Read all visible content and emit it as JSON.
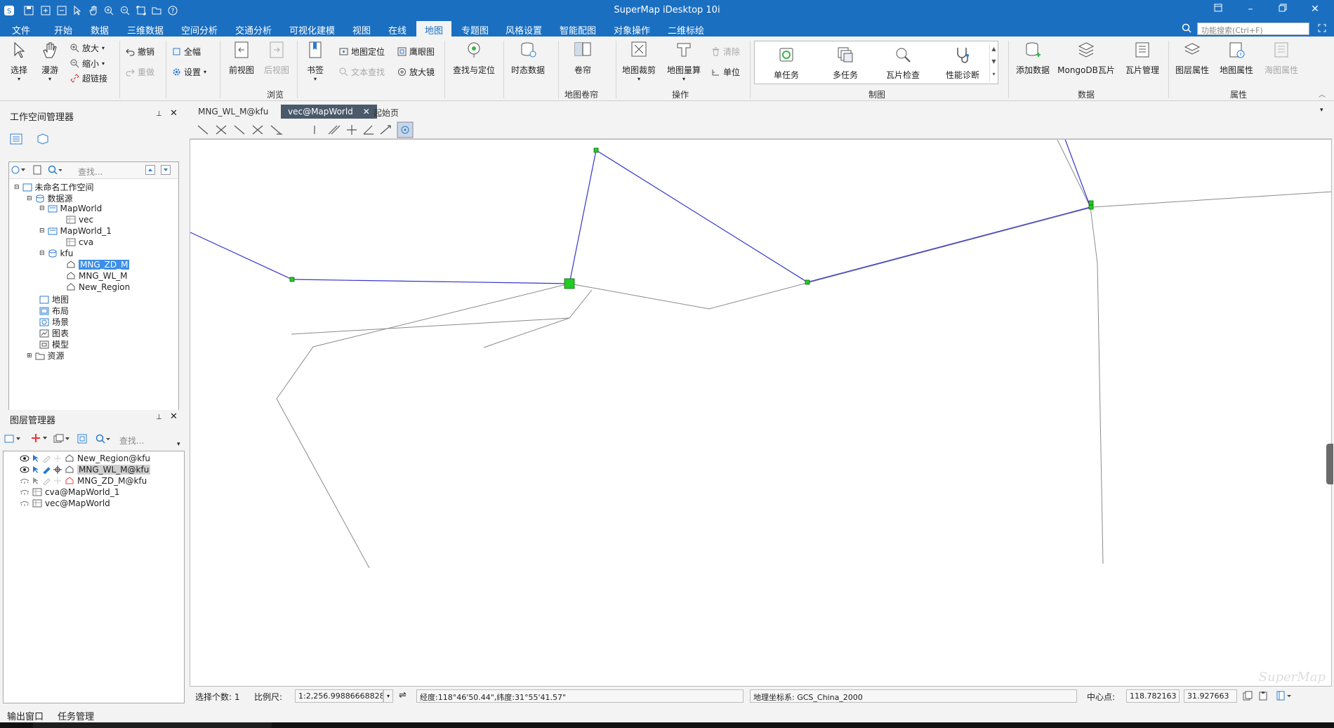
{
  "app": {
    "title": "SuperMap iDesktop 10i"
  },
  "menu": {
    "items": [
      "文件",
      "开始",
      "数据",
      "三维数据",
      "空间分析",
      "交通分析",
      "可视化建模",
      "视图",
      "在线",
      "地图",
      "专题图",
      "风格设置",
      "智能配图",
      "对象操作",
      "二维标绘"
    ],
    "active_index": 9,
    "search_placeholder": "功能搜索(Ctrl+F)"
  },
  "ribbon": {
    "select": "选择",
    "pan": "漫游",
    "zoom_in": "放大",
    "zoom_out": "缩小",
    "hyperlink": "超链接",
    "undo": "撤销",
    "redo": "重做",
    "full_extent": "全幅",
    "settings": "设置",
    "prev_view": "前视图",
    "next_view": "后视图",
    "bookmark": "书签",
    "map_locate": "地图定位",
    "text_search": "文本查找",
    "eagle_eye": "鹰眼图",
    "magnifier": "放大镜",
    "find_locate": "查找与定位",
    "temporal_data": "时态数据",
    "browse_group": "浏览",
    "swipe": "卷帘",
    "swipe_group": "地图卷帘",
    "map_clip": "地图裁剪",
    "map_measure": "地图量算",
    "clear": "清除",
    "unit": "单位",
    "ops_group": "操作",
    "single_task": "单任务",
    "multi_task": "多任务",
    "tile_check": "瓦片检查",
    "perf_diag": "性能诊断",
    "mapping_group": "制图",
    "add_data": "添加数据",
    "mongodb_tiles": "MongoDB瓦片",
    "tile_manage": "瓦片管理",
    "data_group": "数据",
    "layer_props": "图层属性",
    "map_props": "地图属性",
    "chart_props": "海图属性",
    "props_group": "属性"
  },
  "workspace_panel": {
    "title": "工作空间管理器",
    "search_placeholder": "查找...",
    "tree": {
      "root": "未命名工作空间",
      "datasources": "数据源",
      "mapworld": "MapWorld",
      "vec": "vec",
      "mapworld1": "MapWorld_1",
      "cva": "cva",
      "kfu": "kfu",
      "mng_zd": "MNG_ZD_M",
      "mng_wl": "MNG_WL_M",
      "new_region": "New_Region",
      "maps": "地图",
      "layouts": "布局",
      "scenes": "场景",
      "charts": "图表",
      "models": "模型",
      "resources": "资源"
    }
  },
  "layer_panel": {
    "title": "图层管理器",
    "search_placeholder": "查找...",
    "layers": [
      "New_Region@kfu",
      "MNG_WL_M@kfu",
      "MNG_ZD_M@kfu",
      "cva@MapWorld_1",
      "vec@MapWorld"
    ]
  },
  "doc_tabs": [
    "MNG_WL_M@kfu",
    "vec@MapWorld",
    "起始页"
  ],
  "status": {
    "selected_count": "选择个数: 1",
    "scale_label": "比例尺:",
    "scale_value": "1:2,256.99886668828",
    "coords": "经度:118°46'50.44\",纬度:31°55'41.57\"",
    "crs": "地理坐标系: GCS_China_2000",
    "center_label": "中心点:",
    "center_x": "118.782163",
    "center_y": "31.927663"
  },
  "bottom_tabs": [
    "输出窗口",
    "任务管理"
  ],
  "colors": {
    "accent": "#1a6fc1",
    "selection_line": "#3535cc",
    "vertex": "#22cc22",
    "base_line": "#8a8a8a"
  },
  "watermark": "SuperMap"
}
